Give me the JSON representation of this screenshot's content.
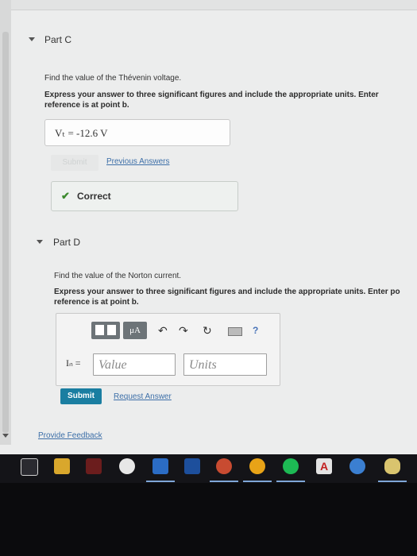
{
  "partC": {
    "title": "Part C",
    "question": "Find the value of the Thévenin voltage.",
    "instruction_line1": "Express your answer to three significant figures and include the appropriate units. Enter",
    "instruction_line2": "reference is at point b.",
    "answer": "Vₜ = -12.6 V",
    "submit_label": "Submit",
    "previous_answers_link": "Previous Answers",
    "feedback": "Correct"
  },
  "partD": {
    "title": "Part D",
    "question": "Find the value of the Norton current.",
    "instruction_line1": "Express your answer to three significant figures and include the appropriate units. Enter po",
    "instruction_line2": "reference is at point b.",
    "toolbar": {
      "mu_a_label": "μA",
      "help": "?"
    },
    "input_label": "Iₙ =",
    "value_placeholder": "Value",
    "units_placeholder": "Units",
    "submit_label": "Submit",
    "request_answer_link": "Request Answer"
  },
  "provide_feedback_link": "Provide Feedback",
  "taskbar": {
    "icons": [
      "settings-icon",
      "file-explorer-icon",
      "app-icon",
      "paint-icon",
      "outlook-icon",
      "word-icon",
      "color-picker-icon",
      "chrome-icon",
      "spotify-icon",
      "acrobat-icon",
      "edge-icon",
      "microphone-icon"
    ]
  }
}
